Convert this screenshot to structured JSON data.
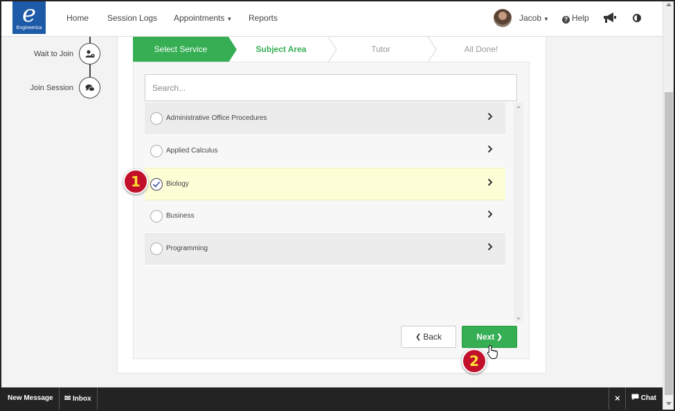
{
  "navbar": {
    "logo_text": "Engineerica",
    "items": [
      {
        "label": "Home"
      },
      {
        "label": "Session Logs"
      },
      {
        "label": "Appointments",
        "has_caret": true
      },
      {
        "label": "Reports"
      }
    ],
    "user_name": "Jacob",
    "help_label": "Help",
    "icons": [
      "user-avatar",
      "help-icon",
      "megaphone-icon",
      "contrast-icon"
    ]
  },
  "side_steps": [
    {
      "label": "Wait to Join",
      "icon": "user-clock-icon"
    },
    {
      "label": "Join Session",
      "icon": "chat-bubbles-icon"
    }
  ],
  "wizard": {
    "tabs": [
      {
        "label": "Select Service",
        "state": "completed"
      },
      {
        "label": "Subject Area",
        "state": "active"
      },
      {
        "label": "Tutor",
        "state": "upcoming"
      },
      {
        "label": "All Done!",
        "state": "upcoming"
      }
    ],
    "search": {
      "placeholder": "Search...",
      "value": ""
    },
    "subjects": [
      {
        "label": "Administrative Office Procedures",
        "selected": false
      },
      {
        "label": "Applied Calculus",
        "selected": false
      },
      {
        "label": "Biology",
        "selected": true
      },
      {
        "label": "Business",
        "selected": false
      },
      {
        "label": "Programming",
        "selected": false
      }
    ],
    "back_label": "Back",
    "next_label": "Next"
  },
  "callouts": [
    "1",
    "2"
  ],
  "bottom_bar": {
    "new_message": "New Message",
    "inbox": "Inbox",
    "close_symbol": "×",
    "chat": "Chat"
  },
  "colors": {
    "brand_blue": "#1d5aa7",
    "green": "#35ae54",
    "selected_row": "#fdfdd6",
    "callout_red": "#c2102b",
    "callout_text": "#ffe033"
  }
}
